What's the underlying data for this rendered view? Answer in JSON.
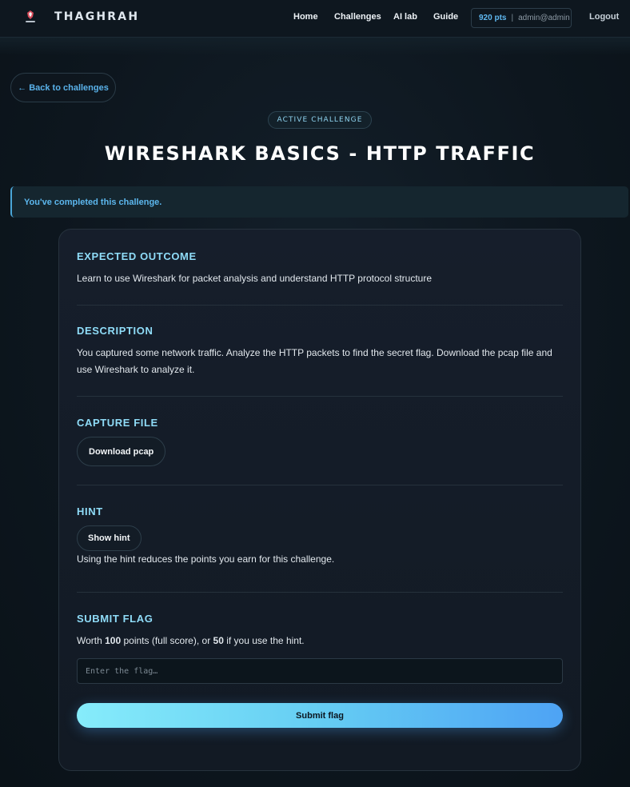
{
  "nav": {
    "brand": "THAGHRAH",
    "links": [
      "Home",
      "Challenges",
      "AI lab",
      "Guide"
    ],
    "points": "920 pts",
    "separator": "|",
    "user": "admin@admin",
    "logout": "Logout"
  },
  "back_label": "← Back to challenges",
  "badge": "ACTIVE CHALLENGE",
  "title": "WIRESHARK BASICS - HTTP TRAFFIC",
  "alert": "You've completed this challenge.",
  "sections": {
    "outcome": {
      "title": "EXPECTED OUTCOME",
      "text": "Learn to use Wireshark for packet analysis and understand HTTP protocol structure"
    },
    "description": {
      "title": "DESCRIPTION",
      "text": "You captured some network traffic. Analyze the HTTP packets to find the secret flag. Download the pcap file and use Wireshark to analyze it."
    },
    "capture": {
      "title": "CAPTURE FILE",
      "button": "Download pcap"
    },
    "hint": {
      "title": "HINT",
      "button": "Show hint",
      "note": "Using the hint reduces the points you earn for this challenge."
    },
    "submit": {
      "title": "SUBMIT FLAG",
      "worth_prefix": "Worth ",
      "full_points": "100",
      "worth_middle": " points (full score), or ",
      "hint_points": "50",
      "worth_suffix": " if you use the hint.",
      "placeholder": "Enter the flag…",
      "button": "Submit flag"
    }
  },
  "colors": {
    "accent": "#8fdcf8",
    "link": "#5ab2ea",
    "button_gradient_start": "#86ecfb",
    "button_gradient_end": "#4ea3f4"
  }
}
